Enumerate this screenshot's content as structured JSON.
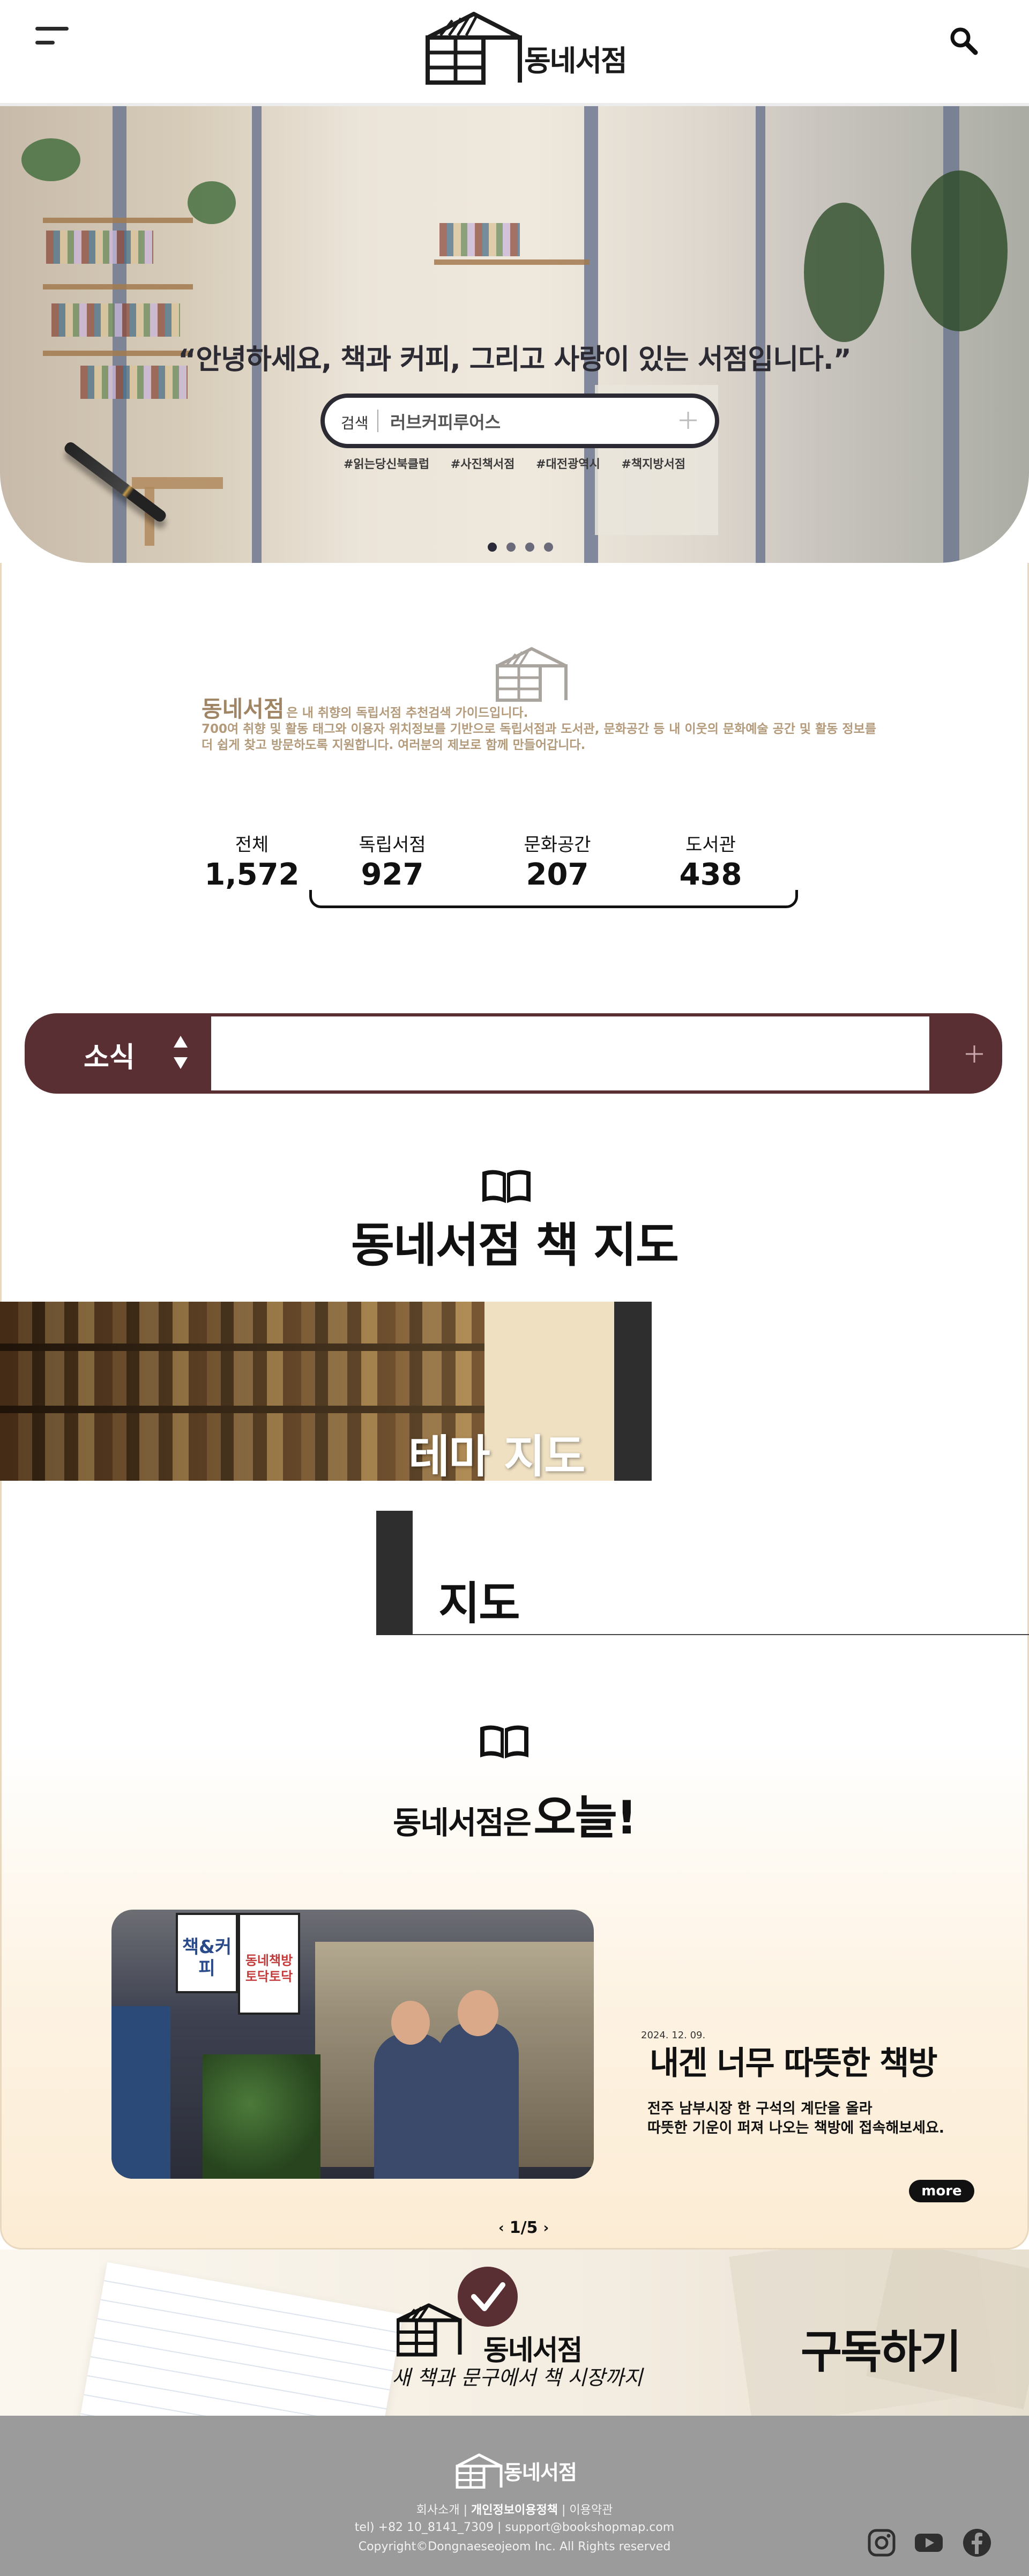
{
  "header": {
    "brand": "동네서점",
    "menu_icon": "hamburger-menu-icon",
    "search_icon": "search-icon"
  },
  "hero": {
    "quote": "“안녕하세요, 책과 커피, 그리고 사랑이 있는 서점입니다.”",
    "search_label": "검색",
    "search_value": "러브커피루어스",
    "tags": [
      "#읽는당신북클럽",
      "#사진책서점",
      "#대전광역시",
      "#책지방서점"
    ],
    "slide_count": 4,
    "active_slide": 1
  },
  "intro": {
    "brand": "동네서점",
    "text_line1": "은 내 취향의 독립서점 추천검색 가이드입니다.",
    "text_line2": "700여 취향 및 활동 태그와 이용자 위치정보를 기반으로 독립서점과 도서관, 문화공간 등 내 이웃의 문화예술 공간 및 활동 정보를",
    "text_line3": "더 쉽게 찾고 방문하도록 지원합니다. 여러분의 제보로 함께 만들어갑니다."
  },
  "stats": [
    {
      "label": "전체",
      "value": "1,572"
    },
    {
      "label": "독립서점",
      "value": "927"
    },
    {
      "label": "문화공간",
      "value": "207"
    },
    {
      "label": "도서관",
      "value": "438"
    }
  ],
  "news": {
    "label": "소식"
  },
  "book_map": {
    "title": "동네서점 책 지도",
    "theme_map_label": "테마 지도",
    "map_label": "지도"
  },
  "today": {
    "title_a": "동네서점은",
    "title_b": "오늘!",
    "date": "2024. 12. 09.",
    "headline": "내겐 너무 따뜻한 책방",
    "desc_line1": "전주 남부시장 한 구석의 계단을 올라",
    "desc_line2": "따뜻한 기운이 퍼져 나오는 책방에 접속해보세요.",
    "more": "more",
    "pager_prev": "‹",
    "pager_text": "1/5",
    "pager_next": "›",
    "img_sign1": "책&커피",
    "img_sign2": "동네책방 토닥토닥"
  },
  "subscribe": {
    "brand": "동네서점",
    "slogan": "새 책과 문구에서 책 시장까지",
    "button": "구독하기"
  },
  "footer": {
    "brand": "동네서점",
    "link_about": "회사소개",
    "link_privacy": "개인정보이용정책",
    "link_terms": "이용약관",
    "contact": "tel) +82 10_8141_7309 | support@bookshopmap.com",
    "copyright": "Copyright©Dongnaeseojeom Inc. All Rights reserved",
    "social": [
      "instagram-icon",
      "youtube-icon",
      "facebook-icon"
    ]
  }
}
